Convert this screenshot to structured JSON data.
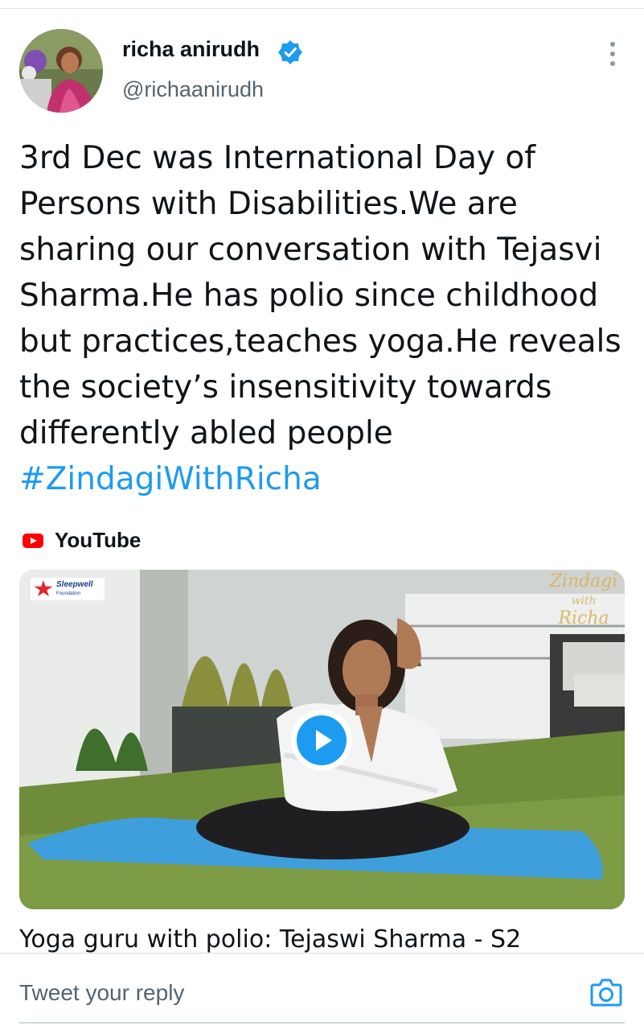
{
  "tweet": {
    "author": {
      "display_name": "richa anirudh",
      "handle": "@richaanirudh",
      "verified": true
    },
    "text_lines": [
      "3rd Dec was International Day of",
      "Persons with Disabilities.We are",
      "sharing our conversation with Tejasvi",
      "Sharma.He has polio since childhood",
      "but practices,teaches yoga.He reveals",
      "the society’s insensitivity towards",
      "differently abled people"
    ],
    "hashtag": "#ZindagiWithRicha"
  },
  "link_card": {
    "source": "YouTube",
    "thumbnail_logos": {
      "left_brand": "Sleepwell",
      "left_brand_sub": "Foundation",
      "right_show_line1": "Zindagi",
      "right_show_line2": "with",
      "right_show_line3": "Richa"
    },
    "title": "Yoga guru with polio: Tejaswi Sharma - S2"
  },
  "reply": {
    "placeholder": "Tweet your reply"
  },
  "colors": {
    "accent": "#1d9bf0",
    "text_primary": "#0f1419",
    "text_secondary": "#536471",
    "youtube_red": "#ff0000"
  },
  "icons": [
    "verified-badge-icon",
    "more-options-icon",
    "youtube-icon",
    "play-icon",
    "camera-icon"
  ]
}
